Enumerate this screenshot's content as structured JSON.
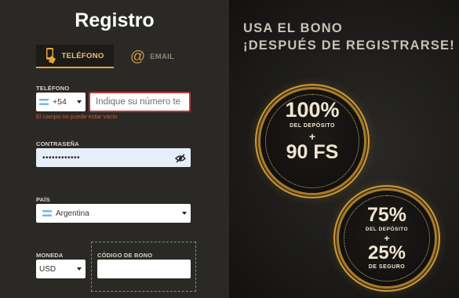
{
  "form": {
    "title": "Registro",
    "tabs": [
      {
        "label": "TELÉFONO",
        "icon": "phone-icon"
      },
      {
        "label": "EMAIL",
        "icon": "at-sign-icon"
      }
    ],
    "phone": {
      "label": "TELÉFONO",
      "country_code": "+54",
      "flag": "argentina-flag-icon",
      "placeholder": "Indique su número te",
      "error": "El campo no puede estar vacío"
    },
    "password": {
      "label": "CONTRASEÑA",
      "masked_value": "••••••••••••",
      "toggle_icon": "eye-off-icon"
    },
    "country": {
      "label": "PAÍS",
      "value": "Argentina"
    },
    "currency": {
      "label": "MONEDA",
      "value": "USD"
    },
    "bonus_code": {
      "label": "CÓDIGO DE BONO",
      "value": ""
    }
  },
  "promo": {
    "headline_1": "USA EL BONO",
    "headline_2": "¡DESPUÉS DE REGISTRARSE!",
    "badge1": {
      "percent": "100%",
      "line": "DEL DEPÓSITO",
      "plus": "+",
      "extra": "90 FS"
    },
    "badge2": {
      "percent": "75%",
      "line": "DEL DEPÓSITO",
      "plus": "+",
      "extra": "25%",
      "extra_line": "DE SEGURO"
    }
  },
  "colors": {
    "accent": "#e6a53a",
    "error": "#d8553f",
    "gold": "#c99a3c"
  }
}
